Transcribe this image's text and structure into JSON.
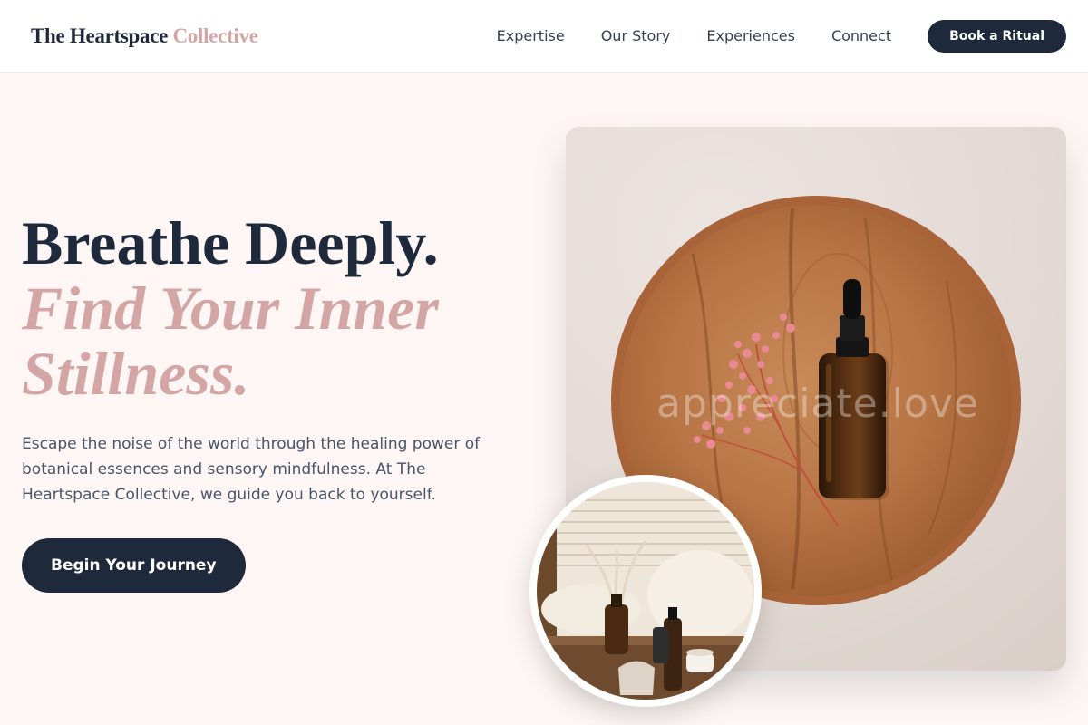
{
  "header": {
    "logo_part1": "The Heartspace",
    "logo_part2": "Collective",
    "nav": [
      {
        "label": "Expertise"
      },
      {
        "label": "Our Story"
      },
      {
        "label": "Experiences"
      },
      {
        "label": "Connect"
      }
    ],
    "cta_label": "Book a Ritual"
  },
  "hero": {
    "headline_line1": "Breathe Deeply.",
    "headline_line2": "Find Your Inner",
    "headline_line3": "Stillness.",
    "description": "Escape the noise of the world through the healing power of botanical essences and sensory mindfulness. At The Heartspace Collective, we guide you back to yourself.",
    "cta_label": "Begin Your Journey"
  },
  "images": {
    "main_watermark": "appreciate.love"
  },
  "colors": {
    "primary": "#1e293b",
    "accent": "#d4a5a5",
    "background": "#fdf6f5"
  }
}
